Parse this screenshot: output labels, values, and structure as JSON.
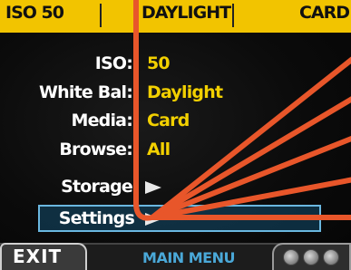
{
  "topbar": {
    "iso": "ISO 50",
    "white_balance": "DAYLIGHT",
    "media": "CARD"
  },
  "menu": [
    {
      "label": "ISO:",
      "value": "50"
    },
    {
      "label": "White Bal:",
      "value": "Daylight"
    },
    {
      "label": "Media:",
      "value": "Card"
    },
    {
      "label": "Browse:",
      "value": "All"
    },
    {
      "label": "Storage",
      "value": "arrow-right-icon"
    },
    {
      "label": "Settings",
      "value": "arrow-right-icon",
      "selected": true
    }
  ],
  "bottombar": {
    "exit_label": "EXIT",
    "main_label": "MAIN MENU",
    "dial_icon": "dial-icon"
  },
  "colors": {
    "topbar_bg": "#f2c400",
    "value_text": "#f2d000",
    "selection_border": "#6ab7e0",
    "main_menu_text": "#4aa8d8",
    "overlay_lines": "#e8562a"
  }
}
